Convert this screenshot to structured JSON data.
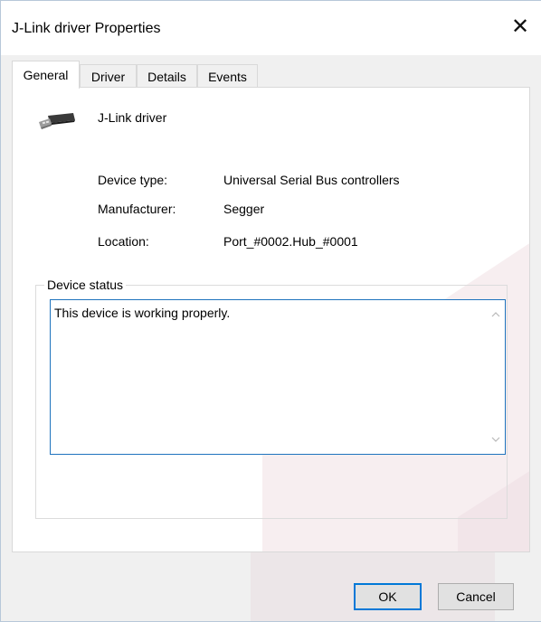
{
  "window": {
    "title": "J-Link driver Properties",
    "close_glyph": "✕"
  },
  "tabs": [
    {
      "label": "General",
      "active": true
    },
    {
      "label": "Driver",
      "active": false
    },
    {
      "label": "Details",
      "active": false
    },
    {
      "label": "Events",
      "active": false
    }
  ],
  "general": {
    "device_name": "J-Link driver",
    "device_icon": "usb-connector-icon",
    "properties": [
      {
        "label": "Device type:",
        "value": "Universal Serial Bus controllers"
      },
      {
        "label": "Manufacturer:",
        "value": "Segger"
      },
      {
        "label": "Location:",
        "value": "Port_#0002.Hub_#0001"
      }
    ],
    "status_group_label": "Device status",
    "status_text": "This device is working properly."
  },
  "buttons": {
    "ok": "OK",
    "cancel": "Cancel"
  },
  "colors": {
    "focus_border": "#1e73be",
    "default_button_border": "#0078d7",
    "watermark": "#f2e5e9"
  }
}
